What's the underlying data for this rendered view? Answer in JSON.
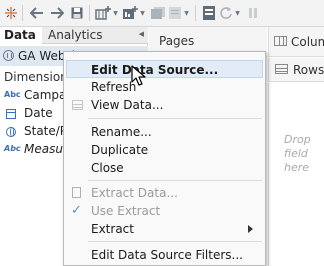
{
  "left_pane": {
    "tabs": {
      "data": "Data",
      "analytics": "Analytics"
    },
    "datasource": "GA Website Data",
    "dimensions_header": "Dimensions",
    "fields": [
      {
        "type_icon": "Abc",
        "label": "Campaign"
      },
      {
        "type_icon": "calendar-icon",
        "label": "Date"
      },
      {
        "type_icon": "globe-icon",
        "label": "State/Province"
      },
      {
        "type_icon": "Abc",
        "label": "Measure Names"
      }
    ]
  },
  "work_area": {
    "pages_label": "Pages",
    "columns_label": "Columns",
    "rows_label": "Rows",
    "drop_hint": "Drop field here"
  },
  "context_menu": {
    "items": [
      {
        "label": "Edit Data Source...",
        "state": "highlighted"
      },
      {
        "label": "Refresh",
        "state": "normal"
      },
      {
        "label": "View Data...",
        "state": "normal",
        "icon": "view-data-icon"
      },
      {
        "label": "Rename...",
        "state": "normal"
      },
      {
        "label": "Duplicate",
        "state": "normal"
      },
      {
        "label": "Close",
        "state": "normal"
      },
      {
        "label": "Extract Data...",
        "state": "disabled",
        "icon": "extract-icon"
      },
      {
        "label": "Use Extract",
        "state": "disabled",
        "icon": "check-icon"
      },
      {
        "label": "Extract",
        "state": "normal",
        "submenu": true
      },
      {
        "label": "Edit Data Source Filters...",
        "state": "normal"
      }
    ]
  },
  "toolbar_icons": [
    "tableau-logo-icon",
    "back-icon",
    "forward-icon",
    "save-icon",
    "new-datasource-icon",
    "dropdown-icon",
    "new-worksheet-icon",
    "dropdown-icon",
    "duplicate-icon",
    "clear-icon",
    "dropdown-icon",
    "pause-icon",
    "refresh-icon",
    "dropdown-icon"
  ]
}
